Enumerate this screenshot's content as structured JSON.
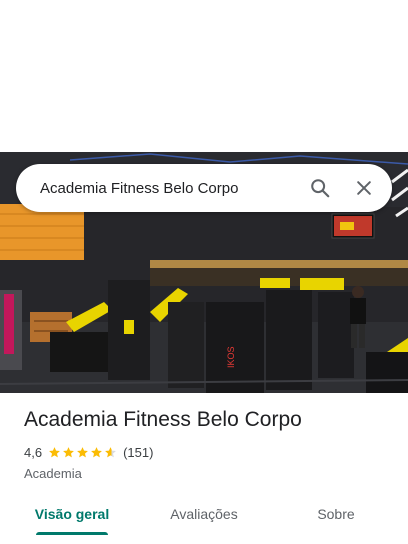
{
  "search": {
    "query": "Academia Fitness Belo Corpo"
  },
  "place": {
    "name": "Academia Fitness Belo Corpo",
    "rating": "4,6",
    "rating_value": 4.6,
    "stars_max": 5,
    "review_count": "(151)",
    "category": "Academia"
  },
  "tabs": [
    {
      "label": "Visão geral",
      "active": true
    },
    {
      "label": "Avaliações",
      "active": false
    },
    {
      "label": "Sobre",
      "active": false
    }
  ],
  "photo": {
    "machine_brand": "IKOS"
  },
  "colors": {
    "accent": "#00796b",
    "star": "#fbbc04",
    "star_empty": "#dadce0"
  },
  "icons": {
    "search": "search-icon",
    "close": "close-icon",
    "star": "star-icon"
  }
}
